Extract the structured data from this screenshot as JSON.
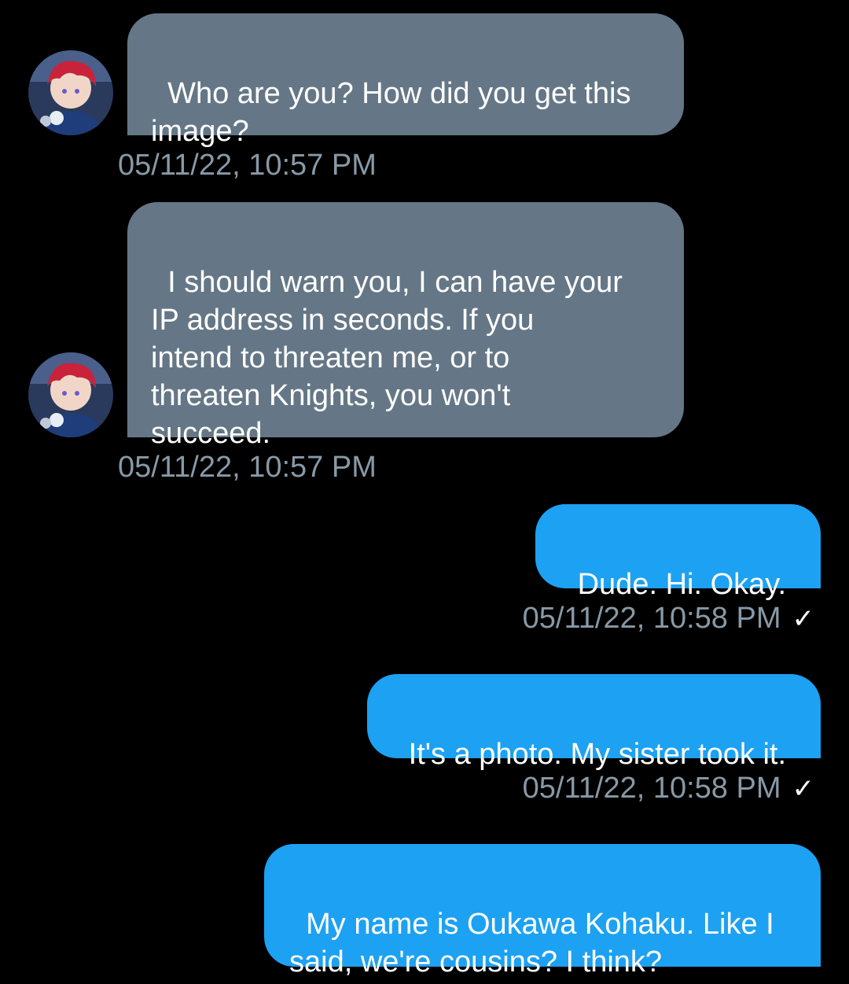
{
  "messages": [
    {
      "side": "received",
      "text": "Who are you? How did you get this\nimage?",
      "timestamp": "05/11/22, 10:57 PM"
    },
    {
      "side": "received",
      "text": "I should warn you, I can have your\nIP address in seconds. If you\nintend to threaten me, or to\nthreaten Knights, you won't\nsucceed.",
      "timestamp": "05/11/22, 10:57 PM"
    },
    {
      "side": "sent",
      "text": "Dude. Hi. Okay.",
      "timestamp": "05/11/22, 10:58 PM",
      "read_icon": "checkmark-icon"
    },
    {
      "side": "sent",
      "text": "It's a photo. My sister took it.",
      "timestamp": "05/11/22, 10:58 PM",
      "read_icon": "checkmark-icon"
    },
    {
      "side": "sent",
      "text": "My name is Oukawa Kohaku. Like I\nsaid, we're cousins? I think?",
      "timestamp": ""
    }
  ],
  "check_glyph": "✓",
  "colors": {
    "background": "#000000",
    "received_bubble": "#657786",
    "sent_bubble": "#1da1f2",
    "timestamp": "#8899a6"
  }
}
